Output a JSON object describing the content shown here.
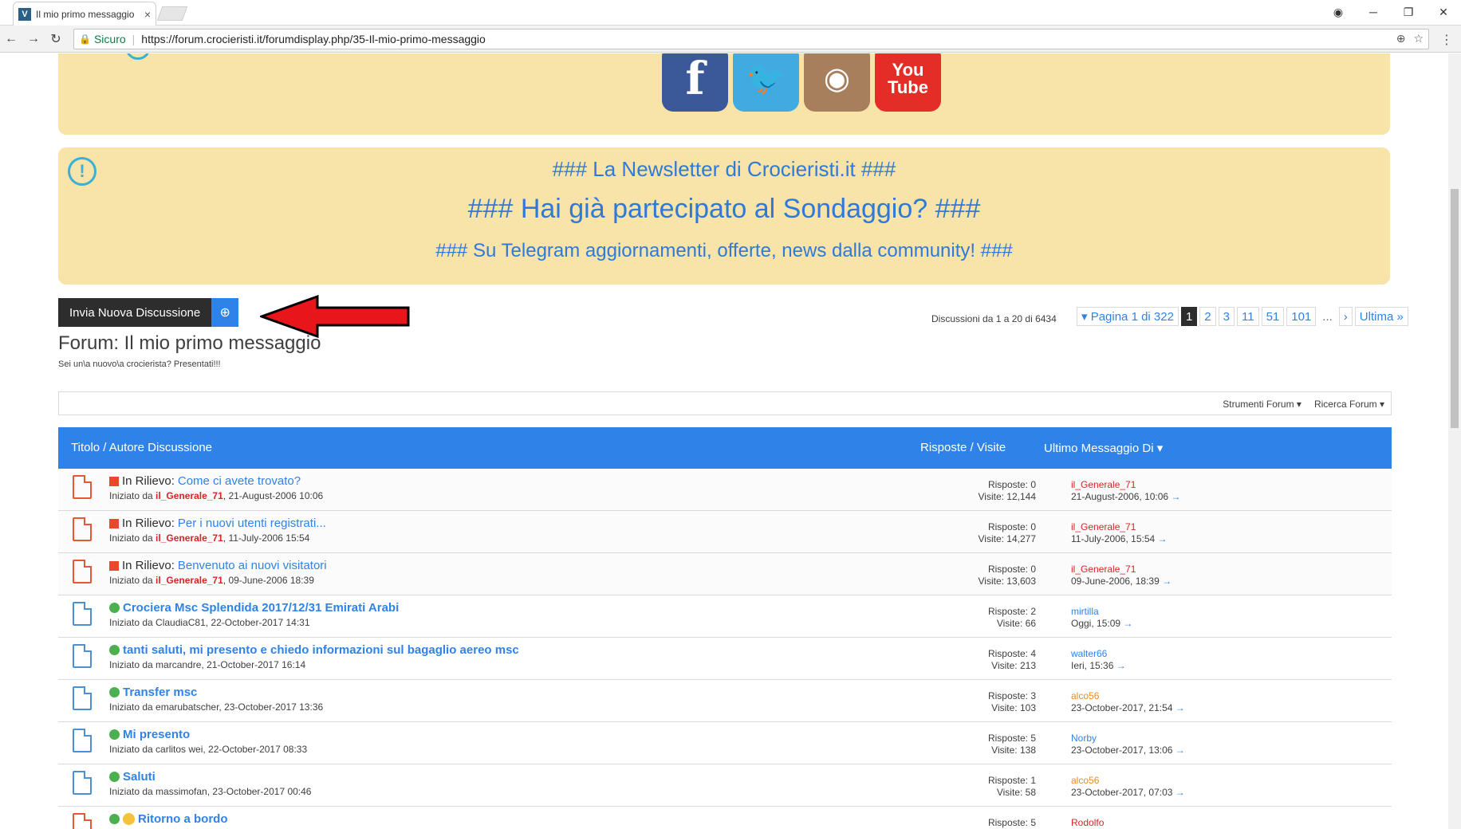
{
  "browser": {
    "tab_title": "Il mio primo messaggio",
    "tab_close": "×",
    "secure_label": "Sicuro",
    "url": "https://forum.crocieristi.it/forumdisplay.php/35-Il-mio-primo-messaggio"
  },
  "notice": {
    "line1": "### La Newsletter di Crocieristi.it ###",
    "line2": "### Hai già partecipato al Sondaggio? ###",
    "line3": "### Su Telegram aggiornamenti, offerte, news dalla community! ###"
  },
  "social": {
    "facebook": "f",
    "twitter": "🐦",
    "instagram": "◉",
    "youtube_1": "You",
    "youtube_2": "Tube"
  },
  "new_thread": {
    "label": "Invia Nuova Discussione",
    "plus": "⊕"
  },
  "pagination": {
    "info": "Discussioni da 1 a 20 di 6434",
    "page_label": "▾ Pagina 1 di 322",
    "pages": [
      "1",
      "2",
      "3",
      "11",
      "51",
      "101"
    ],
    "ellipsis": "...",
    "next": "›",
    "last": "Ultima »"
  },
  "forum": {
    "title": "Forum: Il mio primo messaggio",
    "subtitle": "Sei un\\a nuovo\\a crocierista? Presentati!!!"
  },
  "tools": {
    "forum_tools": "Strumenti Forum ▾",
    "search_forum": "Ricerca Forum ▾"
  },
  "table_header": {
    "title": "Titolo / Autore Discussione",
    "replies": "Risposte / Visite",
    "last": "Ultimo Messaggio Di ▾"
  },
  "threads": [
    {
      "prefix": "In Rilievo:",
      "title": "Come ci avete trovato?",
      "author_prefix": "Iniziato da ",
      "author": "il_Generale_71",
      "date": ", 21-August-2006 10:06",
      "replies": "Risposte: 0",
      "views": "Visite: 12,144",
      "last_user": "il_Generale_71",
      "last_date": "21-August-2006, 10:06"
    },
    {
      "prefix": "In Rilievo:",
      "title": "Per i nuovi utenti registrati...",
      "author_prefix": "Iniziato da ",
      "author": "il_Generale_71",
      "date": ", 11-July-2006 15:54",
      "replies": "Risposte: 0",
      "views": "Visite: 14,277",
      "last_user": "il_Generale_71",
      "last_date": "11-July-2006, 15:54"
    },
    {
      "prefix": "In Rilievo:",
      "title": "Benvenuto ai nuovi visitatori",
      "author_prefix": "Iniziato da ",
      "author": "il_Generale_71",
      "date": ", 09-June-2006 18:39",
      "replies": "Risposte: 0",
      "views": "Visite: 13,603",
      "last_user": "il_Generale_71",
      "last_date": "09-June-2006, 18:39"
    },
    {
      "title": "Crociera Msc Splendida 2017/12/31 Emirati Arabi",
      "author_line": "Iniziato da ClaudiaC81, 22-October-2017 14:31",
      "replies": "Risposte: 2",
      "views": "Visite: 66",
      "last_user": "mirtilla",
      "last_date": "Oggi, 15:09"
    },
    {
      "title": "tanti saluti, mi presento e chiedo informazioni sul bagaglio aereo msc",
      "author_line": "Iniziato da marcandre, 21-October-2017 16:14",
      "replies": "Risposte: 4",
      "views": "Visite: 213",
      "last_user": "walter66",
      "last_date": "Ieri, 15:36"
    },
    {
      "title": "Transfer msc",
      "author_line": "Iniziato da emarubatscher, 23-October-2017 13:36",
      "replies": "Risposte: 3",
      "views": "Visite: 103",
      "last_user": "alco56",
      "last_date": "23-October-2017, 21:54"
    },
    {
      "title": "Mi presento",
      "author_line": "Iniziato da carlitos wei, 22-October-2017 08:33",
      "replies": "Risposte: 5",
      "views": "Visite: 138",
      "last_user": "Norby",
      "last_date": "23-October-2017, 13:06"
    },
    {
      "title": "Saluti",
      "author_line": "Iniziato da massimofan, 23-October-2017 00:46",
      "replies": "Risposte: 1",
      "views": "Visite: 58",
      "last_user": "alco56",
      "last_date": "23-October-2017, 07:03"
    },
    {
      "title": "Ritorno a bordo",
      "replies": "Risposte: 5",
      "last_user": "Rodolfo"
    }
  ],
  "icons": {
    "go": "→"
  }
}
